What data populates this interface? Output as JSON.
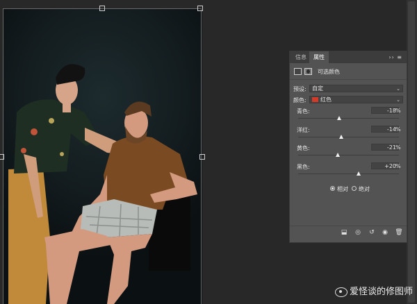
{
  "panel": {
    "tabs": [
      {
        "label": "信息",
        "active": false
      },
      {
        "label": "属性",
        "active": true
      }
    ],
    "menu_glyph": "›› ≡",
    "title": "可选颜色",
    "preset": {
      "label": "预设:",
      "value": "自定"
    },
    "colors": {
      "label": "颜色:",
      "value": "红色",
      "swatch": "#d23a2a"
    },
    "sliders": [
      {
        "label": "青色:",
        "value": "-18",
        "unit": "%",
        "position": -18
      },
      {
        "label": "洋红:",
        "value": "-14",
        "unit": "%",
        "position": -14
      },
      {
        "label": "黄色:",
        "value": "-21",
        "unit": "%",
        "position": -21
      },
      {
        "label": "黑色:",
        "value": "+20",
        "unit": "%",
        "position": 20
      }
    ],
    "method": {
      "relative": "相对",
      "absolute": "绝对",
      "selected": "relative"
    }
  },
  "watermark": "爱怪谈的修图师"
}
